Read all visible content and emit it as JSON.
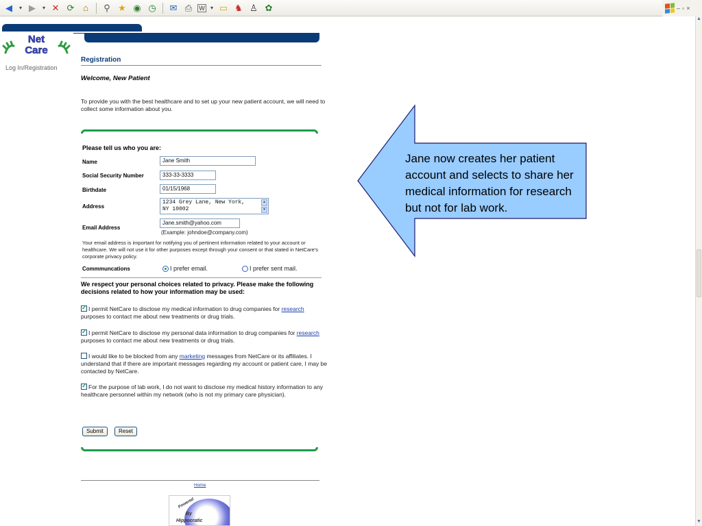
{
  "browser": {
    "toolbar_icons": [
      "back-icon",
      "forward-icon",
      "stop-icon",
      "refresh-icon",
      "home-icon",
      "search-icon",
      "favorites-icon",
      "media-icon",
      "history-icon",
      "mail-icon",
      "print-icon",
      "edit-icon",
      "folder-icon",
      "messenger-icon",
      "research-icon",
      "msn-icon"
    ]
  },
  "sidebar": {
    "logo_line1": "Net",
    "logo_line2": "Care",
    "nav_item": "Log In/Registration"
  },
  "page": {
    "title": "Registration",
    "welcome": "Welcome, New Patient",
    "intro": "To provide you with the best healthcare and to set up your new patient account, we will need to collect some information about you."
  },
  "form": {
    "heading": "Please tell us who you are:",
    "name_label": "Name",
    "name_value": "Jane Smith",
    "ssn_label": "Social Security Number",
    "ssn_value": "333-33-3333",
    "birthdate_label": "Birthdate",
    "birthdate_value": "01/15/1968",
    "address_label": "Address",
    "address_line1": "1234 Grey Lane, New York,",
    "address_line2": "NY 10002",
    "email_label": "Email Address",
    "email_value": "Jane.smith@yahoo.com",
    "email_hint": "(Example: johndoe@company.com)",
    "email_note": "Your email address is important for notifying you of pertinent information related to your account or healthcare. We will not use it for other purposes except through your consent or that stated in NetCare's corporate privacy policy.",
    "comm_label": "Commmuncations",
    "comm_option_email": "I prefer email.",
    "comm_option_mail": "I prefer sent mail.",
    "comm_selected": "email"
  },
  "privacy": {
    "heading": "We respect your personal choices related to privacy. Please make the following decisions related to how your information may be used:",
    "items": [
      {
        "checked": true,
        "pre": "I permit NetCare to disclose my medical information to drug companies for ",
        "link": "research",
        "post": " purposes to contact me about new treatments or drug trials."
      },
      {
        "checked": true,
        "pre": "I permit NetCare to disclose my personal data information to drug companies for ",
        "link": "research",
        "post": " purposes to contact me about new treatments or drug trials."
      },
      {
        "checked": false,
        "pre": "I would like to be blocked from any ",
        "link": "marketing",
        "post": " messages from NetCare or its affiliates. I understand that if there are important messages regarding my account or patient care, I may be contacted by NetCare."
      },
      {
        "checked": true,
        "pre": "For the purpose of lab work, I do not want to disclose my medical history information to any healthcare personnel within my network (who is not my primary care physician).",
        "link": "",
        "post": ""
      }
    ]
  },
  "buttons": {
    "submit": "Submit",
    "reset": "Reset"
  },
  "footer": {
    "home_link": "Home",
    "badge_line1": "Powered",
    "badge_line2": "By",
    "badge_line3": "Hippocratic"
  },
  "callout": {
    "text": "Jane now creates her patient account and selects to share her medical information for research but not for lab work.",
    "fill": "#99ccff"
  }
}
